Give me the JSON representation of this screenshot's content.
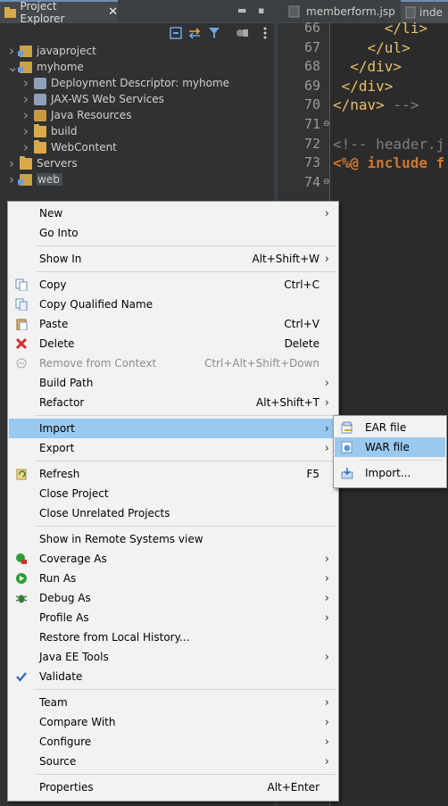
{
  "project_explorer": {
    "title": "Project Explorer",
    "close_glyph": "✕",
    "tree": [
      {
        "label": "javaproject",
        "expanded": false,
        "indent": 0,
        "icon": "project-icon"
      },
      {
        "label": "myhome",
        "expanded": true,
        "indent": 0,
        "icon": "project-icon"
      },
      {
        "label": "Deployment Descriptor: myhome",
        "expanded": false,
        "indent": 1,
        "icon": "descriptor-icon"
      },
      {
        "label": "JAX-WS Web Services",
        "expanded": false,
        "indent": 1,
        "icon": "webservice-icon"
      },
      {
        "label": "Java Resources",
        "expanded": false,
        "indent": 1,
        "icon": "java-resources-icon"
      },
      {
        "label": "build",
        "expanded": false,
        "indent": 1,
        "icon": "folder-icon"
      },
      {
        "label": "WebContent",
        "expanded": false,
        "indent": 1,
        "icon": "folder-icon"
      },
      {
        "label": "Servers",
        "expanded": false,
        "indent": 0,
        "icon": "folder-icon"
      },
      {
        "label": "web",
        "expanded": false,
        "indent": 0,
        "icon": "project-icon",
        "selected": true
      }
    ]
  },
  "editor": {
    "tabs": [
      "memberform.jsp",
      "inde"
    ],
    "lines": [
      {
        "n": "66",
        "html": "<span class='c-txt'>      </span><span class='c-tag'>&lt;/li&gt;</span>"
      },
      {
        "n": "67",
        "html": "<span class='c-txt'>    </span><span class='c-tag'>&lt;/ul&gt;</span>"
      },
      {
        "n": "68",
        "html": "<span class='c-txt'>  </span><span class='c-tag'>&lt;/div&gt;</span>"
      },
      {
        "n": "69",
        "html": "<span class='c-txt'> </span><span class='c-tag'>&lt;/div&gt;</span>"
      },
      {
        "n": "70",
        "html": "<span class='c-tag'>&lt;/nav&gt;</span><span class='c-com'> --&gt;</span>"
      },
      {
        "n": "71",
        "html": "",
        "fold": true
      },
      {
        "n": "72",
        "html": "<span class='c-com'>&lt;!-- header.j</span>"
      },
      {
        "n": "73",
        "html": "<span class='c-dir'>&lt;%@ include f</span>"
      },
      {
        "n": "74",
        "html": "",
        "fold": true
      }
    ]
  },
  "context_menu": {
    "items": [
      {
        "label": "New",
        "submenu": true
      },
      {
        "label": "Go Into"
      },
      {
        "sep": true
      },
      {
        "label": "Show In",
        "accel": "Alt+Shift+W",
        "submenu": true
      },
      {
        "sep": true
      },
      {
        "label": "Copy",
        "accel": "Ctrl+C",
        "icon": "copy-icon"
      },
      {
        "label": "Copy Qualified Name",
        "icon": "copy-qualified-icon"
      },
      {
        "label": "Paste",
        "accel": "Ctrl+V",
        "icon": "paste-icon"
      },
      {
        "label": "Delete",
        "accel": "Delete",
        "icon": "delete-icon"
      },
      {
        "label": "Remove from Context",
        "accel": "Ctrl+Alt+Shift+Down",
        "disabled": true,
        "icon": "remove-context-icon"
      },
      {
        "label": "Build Path",
        "submenu": true
      },
      {
        "label": "Refactor",
        "accel": "Alt+Shift+T",
        "submenu": true
      },
      {
        "sep": true
      },
      {
        "label": "Import",
        "submenu": true,
        "highlight": true
      },
      {
        "label": "Export",
        "submenu": true
      },
      {
        "sep": true
      },
      {
        "label": "Refresh",
        "accel": "F5",
        "icon": "refresh-icon"
      },
      {
        "label": "Close Project"
      },
      {
        "label": "Close Unrelated Projects"
      },
      {
        "sep": true
      },
      {
        "label": "Show in Remote Systems view"
      },
      {
        "label": "Coverage As",
        "submenu": true,
        "icon": "coverage-icon"
      },
      {
        "label": "Run As",
        "submenu": true,
        "icon": "run-icon"
      },
      {
        "label": "Debug As",
        "submenu": true,
        "icon": "debug-icon"
      },
      {
        "label": "Profile As",
        "submenu": true
      },
      {
        "label": "Restore from Local History..."
      },
      {
        "label": "Java EE Tools",
        "submenu": true
      },
      {
        "label": "Validate",
        "icon": "check-icon"
      },
      {
        "sep": true
      },
      {
        "label": "Team",
        "submenu": true
      },
      {
        "label": "Compare With",
        "submenu": true
      },
      {
        "label": "Configure",
        "submenu": true
      },
      {
        "label": "Source",
        "submenu": true
      },
      {
        "sep": true
      },
      {
        "label": "Properties",
        "accel": "Alt+Enter"
      }
    ]
  },
  "import_submenu": {
    "items": [
      {
        "label": "EAR file",
        "icon": "ear-file-icon"
      },
      {
        "label": "WAR file",
        "icon": "war-file-icon",
        "highlight": true
      },
      {
        "sep": true
      },
      {
        "label": "Import...",
        "icon": "import-icon"
      }
    ]
  },
  "colors": {
    "highlight": "#99c9ef",
    "menu_bg": "#f2f2f2",
    "editor_bg": "#2b2b2b",
    "explorer_bg": "#2f3133"
  }
}
